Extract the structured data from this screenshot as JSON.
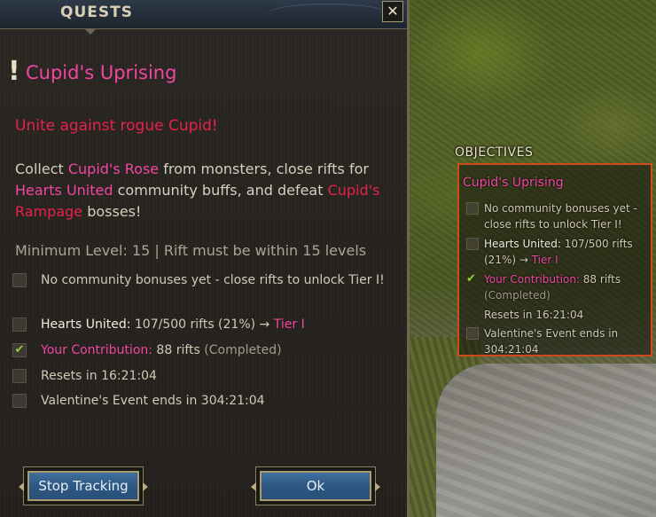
{
  "window": {
    "title": "QUESTS",
    "close_label": "✕"
  },
  "quest": {
    "marker": "!",
    "name": "Cupid's Uprising",
    "subtitle": "Unite against rogue Cupid!",
    "desc": {
      "p1": "Collect ",
      "h1": "Cupid's Rose",
      "p2": " from monsters, close rifts for ",
      "h2": "Hearts United",
      "p3": " community buffs, and defeat ",
      "h3": "Cupid's Rampage",
      "p4": " bosses!"
    },
    "min_level": "Minimum Level: 15 | Rift must be within 15 levels",
    "objectives": [
      {
        "text": "No community bonuses yet - close rifts to unlock Tier I!",
        "done": false
      },
      {
        "label": "Hearts United:",
        "value": " 107/500 rifts (21%) → ",
        "tier": "Tier I",
        "done": false
      },
      {
        "label": "Your Contribution:",
        "value": " 88 rifts ",
        "status": "(Completed)",
        "done": true
      },
      {
        "text": "Resets in 16:21:04",
        "done": false
      },
      {
        "text": "Valentine's Event ends in 304:21:04",
        "done": false
      }
    ],
    "check_glyph": "✔"
  },
  "buttons": {
    "stop_tracking": "Stop Tracking",
    "ok": "Ok"
  },
  "tracker": {
    "header": "OBJECTIVES",
    "title": "Cupid's Uprising",
    "rows": [
      {
        "text": "No community bonuses yet - close rifts to unlock Tier I!"
      },
      {
        "label": "Hearts United:",
        "value": " 107/500 rifts (21%) → ",
        "tier": "Tier I"
      },
      {
        "label": "Your Contribution:",
        "value": " 88 rifts",
        "status": "(Completed)"
      },
      {
        "text": "Resets in 16:21:04"
      },
      {
        "text": "Valentine's Event ends in 304:21:04"
      }
    ]
  },
  "colors": {
    "accent_pink": "#f245a2",
    "accent_red": "#e8214b",
    "tracker_border": "#d2491b",
    "check_green": "#8fd23a"
  }
}
